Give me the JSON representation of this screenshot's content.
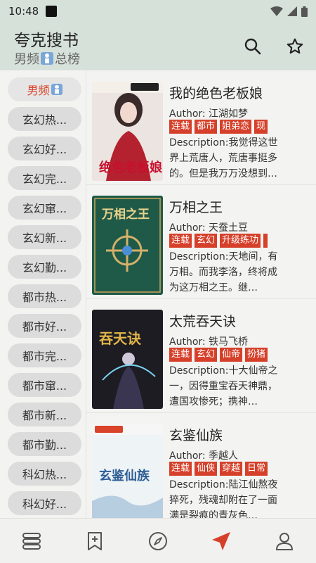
{
  "status_bar": {
    "time": "10:48"
  },
  "app_bar": {
    "title": "夸克搜书",
    "subtitle_prefix": "男频",
    "subtitle_suffix": "总榜"
  },
  "sidebar": {
    "items": [
      {
        "label": "男频",
        "active": true,
        "has_gender_icon": true
      },
      {
        "label": "玄幻热..."
      },
      {
        "label": "玄幻好..."
      },
      {
        "label": "玄幻完..."
      },
      {
        "label": "玄幻窜..."
      },
      {
        "label": "玄幻新..."
      },
      {
        "label": "玄幻勤..."
      },
      {
        "label": "都市热..."
      },
      {
        "label": "都市好..."
      },
      {
        "label": "都市完..."
      },
      {
        "label": "都市窜..."
      },
      {
        "label": "都市新..."
      },
      {
        "label": "都市勤..."
      },
      {
        "label": "科幻热..."
      },
      {
        "label": "科幻好..."
      }
    ]
  },
  "books": [
    {
      "title": "我的绝色老板娘",
      "author": "Author: 江湖如梦",
      "tags": [
        "连载",
        "都市",
        "姐弟恋",
        "现"
      ],
      "description": "Description:我觉得这世界上荒唐人，荒唐事挺多的。但是我万万没想到…",
      "cover_text": "绝色老板娘"
    },
    {
      "title": "万相之王",
      "author": "Author: 天蚕土豆",
      "tags": [
        "连载",
        "玄幻",
        "升级练功",
        ""
      ],
      "description": "Description:天地间，有万相。而我李洛，终将成为这万相之王。继…",
      "cover_text": "万相之王"
    },
    {
      "title": "太荒吞天诀",
      "author": "Author: 铁马飞桥",
      "tags": [
        "连载",
        "玄幻",
        "仙帝",
        "扮猪"
      ],
      "description": "Description:十大仙帝之一，因得重宝吞天神鼎，遭国攻惨死；携神…",
      "cover_text": "吞天诀"
    },
    {
      "title": "玄鉴仙族",
      "author": "Author: 季越人",
      "tags": [
        "连载",
        "仙侠",
        "穿越",
        "日常"
      ],
      "description": "Description:陆江仙熬夜猝死，残魂却附在了一面满是裂痕的青灰色…",
      "cover_text": "玄鉴仙族"
    }
  ],
  "bottom_nav": [
    {
      "name": "bookshelf",
      "icon": "stack-icon",
      "active": false
    },
    {
      "name": "bookmark",
      "icon": "bookmark-add-icon",
      "active": false
    },
    {
      "name": "explore",
      "icon": "compass-icon",
      "active": false
    },
    {
      "name": "rank",
      "icon": "send-icon",
      "active": true
    },
    {
      "name": "profile",
      "icon": "person-icon",
      "active": false
    }
  ],
  "colors": {
    "accent": "#d6402a",
    "header_bg": "#d6e1da"
  }
}
